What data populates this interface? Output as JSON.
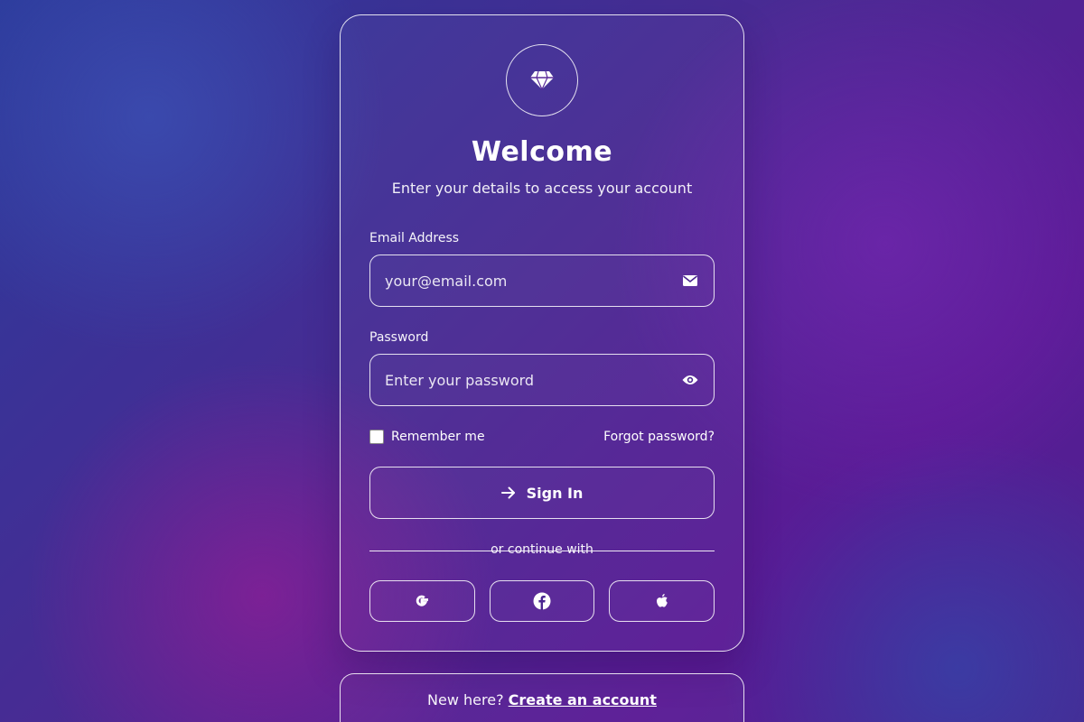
{
  "header": {
    "logo_icon": "gem-icon",
    "title": "Welcome",
    "subtitle": "Enter your details to access your account"
  },
  "form": {
    "email": {
      "label": "Email Address",
      "placeholder": "your@email.com",
      "value": "",
      "icon": "envelope-icon"
    },
    "password": {
      "label": "Password",
      "placeholder": "Enter your password",
      "value": "",
      "icon": "eye-icon"
    },
    "remember_label": "Remember me",
    "remember_checked": false,
    "forgot_label": "Forgot password?",
    "submit_label": "Sign In",
    "submit_icon": "arrow-right-icon"
  },
  "divider_text": "or continue with",
  "social": [
    {
      "name": "google",
      "icon": "google-icon"
    },
    {
      "name": "facebook",
      "icon": "facebook-icon"
    },
    {
      "name": "apple",
      "icon": "apple-icon"
    }
  ],
  "footer": {
    "prompt": "New here?",
    "link_label": "Create an account"
  },
  "colors": {
    "background_start": "#2b3a9a",
    "background_end": "#5a1a95",
    "text": "#ffffff"
  }
}
